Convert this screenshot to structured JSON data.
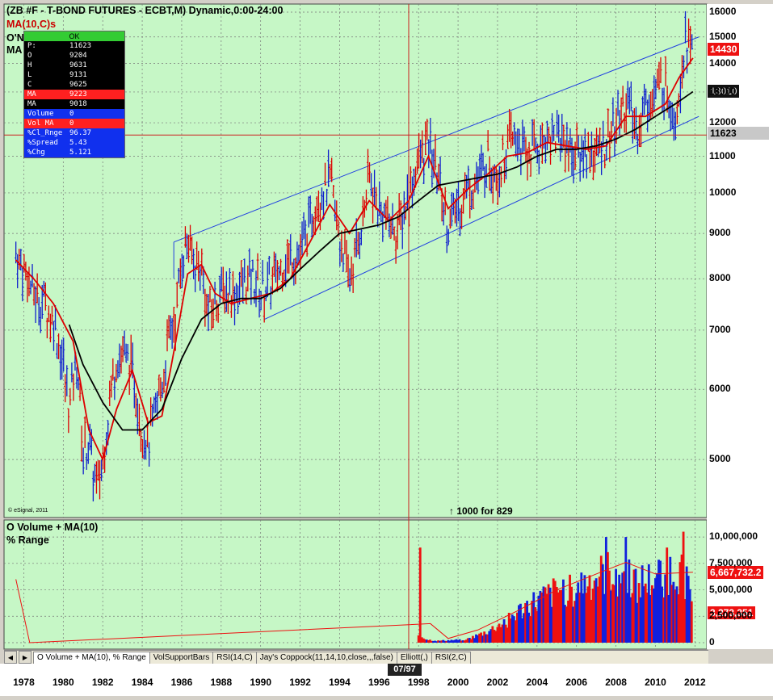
{
  "header": {
    "title": "(ZB #F - T-BOND FUTURES - ECBT,M) Dynamic,0:00-24:00",
    "ma_line": "MA(10,C)s",
    "cut_label_1": "O'N",
    "cut_label_2": "MA"
  },
  "databox": {
    "status": "OK",
    "rows": [
      {
        "k": "P:",
        "v": "11623",
        "style": "black"
      },
      {
        "k": "O",
        "v": "9204",
        "style": "black"
      },
      {
        "k": "H",
        "v": "9631",
        "style": "black"
      },
      {
        "k": "L",
        "v": "9131",
        "style": "black"
      },
      {
        "k": "C",
        "v": "9625",
        "style": "black"
      },
      {
        "k": "MA",
        "v": "9223",
        "style": "red"
      },
      {
        "k": "MA",
        "v": "9018",
        "style": "black"
      },
      {
        "k": "Volume",
        "v": "0",
        "style": "blue"
      },
      {
        "k": "Vol MA",
        "v": "0",
        "style": "red"
      },
      {
        "k": "%Cl_Rnge",
        "v": "96.37",
        "style": "blue"
      },
      {
        "k": "%Spread",
        "v": "5.43",
        "style": "blue"
      },
      {
        "k": "%Chg",
        "v": "5.121",
        "style": "blue"
      }
    ]
  },
  "copyright": "© eSignal, 2011",
  "annotation": "↑ 1000 for 829",
  "subpanel": {
    "label1": "O Volume + MA(10)",
    "label2": "% Range"
  },
  "tabs": [
    {
      "label": "O Volume + MA(10), % Range",
      "active": true
    },
    {
      "label": "VolSupportBars",
      "active": false
    },
    {
      "label": "RSI(14,C)",
      "active": false
    },
    {
      "label": "Jay's Coppock(11,14,10,close,,,false)",
      "active": false
    },
    {
      "label": "Elliott(,)",
      "active": false
    },
    {
      "label": "RSI(2,C)",
      "active": false
    }
  ],
  "cursor_date": "07/97",
  "price_boxes": {
    "last": "14430",
    "ma_slow": "13010",
    "cursor": "11623",
    "vol": "6,667,732.2",
    "vol_ma": "3,273,351"
  },
  "colors": {
    "background": "#c6f7c6",
    "grid": "#777777",
    "bars": "#1020cc",
    "ma_fast": "#dd0000",
    "ma_slow": "#000000",
    "channel": "#2040e0",
    "crosshair": "#cc2020",
    "vol_red": "#ee1010",
    "vol_blue": "#1020dd"
  },
  "chart_data": [
    {
      "type": "line",
      "title": "(ZB #F - T-BOND FUTURES - ECBT,M) Dynamic,0:00-24:00",
      "x_ticks": [
        "1978",
        "1980",
        "1982",
        "1984",
        "1986",
        "1988",
        "1990",
        "1992",
        "1994",
        "1996",
        "1998",
        "2000",
        "2002",
        "2004",
        "2006",
        "2008",
        "2010",
        "2012"
      ],
      "y_ticks": [
        5000,
        6000,
        7000,
        8000,
        9000,
        10000,
        11000,
        12000,
        13000,
        14000,
        15000,
        16000
      ],
      "y_scale": "log",
      "ylim": [
        4300,
        16000
      ],
      "xlim": [
        1977,
        2012.6
      ],
      "grid": true,
      "series": [
        {
          "name": "Price (monthly close)",
          "x": [
            1977.6,
            1978,
            1978.5,
            1979,
            1979.5,
            1980,
            1980.3,
            1980.7,
            1981,
            1981.3,
            1981.7,
            1982,
            1982.3,
            1982.7,
            1983,
            1983.5,
            1984,
            1984.3,
            1984.7,
            1985,
            1985.3,
            1985.7,
            1986,
            1986.3,
            1986.7,
            1987,
            1987.3,
            1987.7,
            1988,
            1988.5,
            1989,
            1989.5,
            1990,
            1990.5,
            1991,
            1991.5,
            1992,
            1992.5,
            1993,
            1993.5,
            1994,
            1994.5,
            1995,
            1995.5,
            1996,
            1996.5,
            1997,
            1997.5,
            1998,
            1998.5,
            1999,
            1999.5,
            2000,
            2000.5,
            2001,
            2001.5,
            2002,
            2002.5,
            2003,
            2003.5,
            2004,
            2004.5,
            2005,
            2005.5,
            2006,
            2006.5,
            2007,
            2007.5,
            2008,
            2008.5,
            2009,
            2009.5,
            2010,
            2010.5,
            2011,
            2011.5,
            2011.9
          ],
          "y": [
            8500,
            8200,
            7700,
            7500,
            7200,
            6400,
            5700,
            6500,
            5100,
            5200,
            4600,
            5000,
            5700,
            6500,
            6600,
            6300,
            5400,
            5200,
            5700,
            6100,
            6700,
            7300,
            8400,
            8900,
            8200,
            8400,
            7300,
            7500,
            7800,
            7700,
            7800,
            8100,
            7700,
            7900,
            8200,
            8500,
            8600,
            9200,
            10000,
            10300,
            8900,
            8000,
            8900,
            10400,
            9600,
            9300,
            9100,
            10000,
            10900,
            11400,
            10400,
            9200,
            9700,
            10200,
            10300,
            11000,
            10500,
            11400,
            11500,
            11000,
            11300,
            11600,
            11600,
            11400,
            11000,
            11200,
            11100,
            11400,
            12000,
            12700,
            11800,
            12500,
            13000,
            13400,
            12200,
            14800,
            14430
          ]
        },
        {
          "name": "MA(10)",
          "x": [
            1977.6,
            1978.5,
            1979.5,
            1980.5,
            1981.3,
            1982,
            1982.7,
            1983.5,
            1984.3,
            1985,
            1985.7,
            1986.3,
            1987,
            1987.7,
            1988.5,
            1989.5,
            1990.5,
            1991.5,
            1992.5,
            1993.5,
            1994.5,
            1995.5,
            1996.5,
            1997.5,
            1998.5,
            1999.5,
            2000.5,
            2001.5,
            2002.5,
            2003.5,
            2004.5,
            2005.5,
            2006.5,
            2007.5,
            2008.5,
            2009.5,
            2010.5,
            2011.2,
            2011.9
          ],
          "y": [
            8400,
            8000,
            7500,
            6800,
            5400,
            5000,
            5700,
            6300,
            5500,
            5600,
            6800,
            8100,
            8300,
            7700,
            7500,
            7600,
            7700,
            8000,
            8800,
            9700,
            9000,
            9800,
            9300,
            9800,
            11000,
            9600,
            10100,
            10500,
            11000,
            11100,
            11400,
            11300,
            11200,
            11300,
            12200,
            12200,
            12600,
            13500,
            14200
          ]
        },
        {
          "name": "MA(10) slow",
          "x": [
            1980.3,
            1981,
            1982,
            1983,
            1984,
            1985,
            1986,
            1987,
            1988,
            1989,
            1990,
            1991,
            1992,
            1993,
            1994,
            1995,
            1996,
            1997,
            1998,
            1999,
            2000,
            2001,
            2002,
            2003,
            2004,
            2005,
            2006,
            2007,
            2008,
            2009,
            2010,
            2011,
            2011.9
          ],
          "y": [
            7100,
            6400,
            5800,
            5400,
            5400,
            5700,
            6500,
            7200,
            7500,
            7600,
            7600,
            7800,
            8200,
            8600,
            9000,
            9100,
            9200,
            9400,
            9800,
            10200,
            10300,
            10400,
            10500,
            10700,
            11000,
            11200,
            11200,
            11300,
            11500,
            11800,
            12200,
            12600,
            13010
          ]
        },
        {
          "name": "Channel upper",
          "x": [
            1985.6,
            2012.2
          ],
          "y": [
            8800,
            15000
          ]
        },
        {
          "name": "Channel lower",
          "x": [
            1990.2,
            2012.2
          ],
          "y": [
            7200,
            12200
          ]
        }
      ],
      "horizontal_line": 11623,
      "vertical_line_year": 1997.5
    },
    {
      "type": "bar",
      "title": "O Volume + MA(10)",
      "ylabel": "% Range",
      "y_ticks": [
        "0",
        "2,500,000",
        "5,000,000",
        "7,500,000",
        "10,000,000"
      ],
      "ylim": [
        0,
        11000000
      ],
      "bars_start_year": 1998,
      "bars_end_year": 2011.9,
      "volume_profile": [
        [
          1998,
          800000
        ],
        [
          1998.5,
          300000
        ],
        [
          1999,
          200000
        ],
        [
          1999.5,
          250000
        ],
        [
          2000,
          300000
        ],
        [
          2000.5,
          400000
        ],
        [
          2001,
          800000
        ],
        [
          2001.5,
          1200000
        ],
        [
          2002,
          1800000
        ],
        [
          2002.5,
          2500000
        ],
        [
          2003,
          3200000
        ],
        [
          2003.5,
          4000000
        ],
        [
          2004,
          4500000
        ],
        [
          2004.5,
          5000000
        ],
        [
          2005,
          5500000
        ],
        [
          2005.5,
          6000000
        ],
        [
          2006,
          6200000
        ],
        [
          2006.5,
          6500000
        ],
        [
          2007,
          7000000
        ],
        [
          2007.5,
          7500000
        ],
        [
          2008,
          7800000
        ],
        [
          2008.5,
          7500000
        ],
        [
          2009,
          6800000
        ],
        [
          2009.5,
          6500000
        ],
        [
          2010,
          7000000
        ],
        [
          2010.5,
          7500000
        ],
        [
          2011,
          8000000
        ],
        [
          2011.5,
          7200000
        ],
        [
          2011.9,
          6667732
        ]
      ],
      "spikes": [
        [
          1998.1,
          9000000
        ],
        [
          2007.5,
          10000000
        ],
        [
          2008.5,
          10000000
        ],
        [
          2010.6,
          9000000
        ],
        [
          2011.4,
          10500000
        ]
      ],
      "vol_ma": [
        [
          1977.6,
          6000000
        ],
        [
          1978.3,
          0
        ],
        [
          1998.6,
          1800000
        ],
        [
          1999.5,
          400000
        ],
        [
          2001,
          1200000
        ],
        [
          2003,
          3000000
        ],
        [
          2005,
          5000000
        ],
        [
          2007,
          6500000
        ],
        [
          2008.5,
          7600000
        ],
        [
          2010,
          6500000
        ],
        [
          2011.9,
          6667732
        ]
      ],
      "last_value": "6,667,732.2",
      "ma_value": "3,273,351"
    }
  ]
}
